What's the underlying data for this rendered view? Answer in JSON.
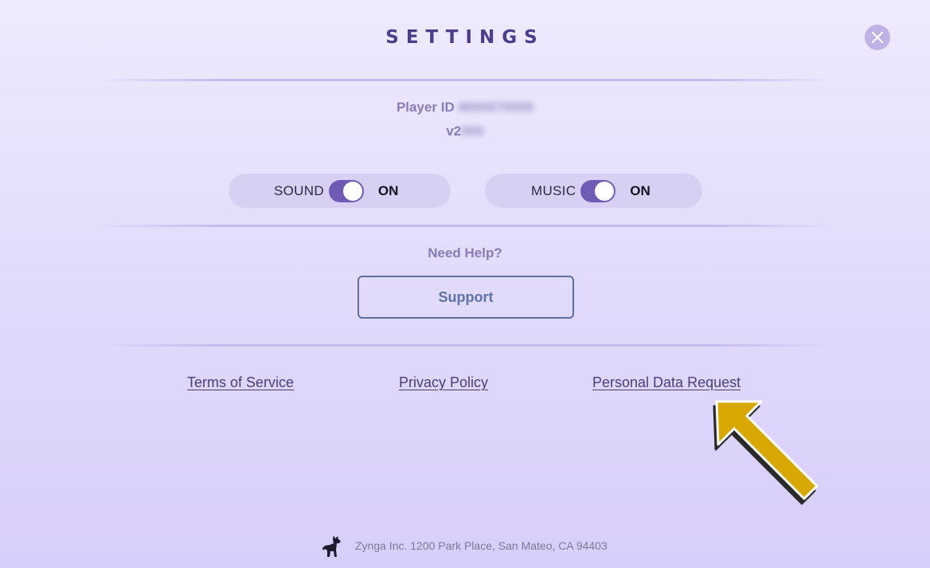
{
  "header": {
    "title": "SETTINGS",
    "close_icon": "close-icon"
  },
  "info": {
    "player_id_label": "Player ID",
    "player_id_value": "9000070000",
    "version_prefix": "v2",
    "version_value": "000"
  },
  "toggles": {
    "sound": {
      "label": "SOUND",
      "state": "ON",
      "on": true
    },
    "music": {
      "label": "MUSIC",
      "state": "ON",
      "on": true
    }
  },
  "help": {
    "heading": "Need Help?",
    "support_label": "Support"
  },
  "links": {
    "terms": "Terms of Service",
    "privacy": "Privacy Policy",
    "personal_data": "Personal Data Request"
  },
  "annotation": {
    "arrow_icon": "pointer-arrow-icon",
    "arrow_color": "#d9a800"
  },
  "footer": {
    "logo_icon": "zynga-dog-icon",
    "address": "Zynga Inc. 1200 Park Place, San Mateo, CA 94403"
  },
  "colors": {
    "accent": "#6f5bb5",
    "title": "#4d3b8c",
    "link": "#4a3f7a"
  }
}
